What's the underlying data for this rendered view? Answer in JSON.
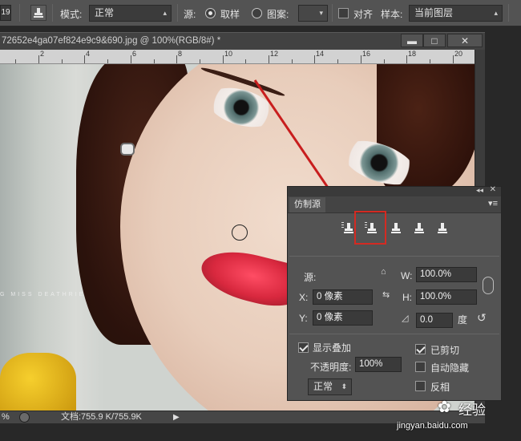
{
  "options_bar": {
    "brush_size": "19",
    "mode_label": "模式:",
    "mode_value": "正常",
    "source_label": "源:",
    "source_sampled": "取样",
    "source_pattern": "图案:",
    "aligned_label": "对齐",
    "sample_label": "样本:",
    "sample_value": "当前图层"
  },
  "document": {
    "title": "72652e4ga07ef824e9c9&690.jpg @ 100%(RGB/8#) *",
    "ruler_numbers": [
      "2",
      "4",
      "6",
      "8",
      "10",
      "12",
      "14",
      "16",
      "18",
      "20"
    ],
    "watermark": "G MISS DEATHRIE",
    "status_zoom": "%",
    "status_doc": "文档:755.9 K/755.9K"
  },
  "panel": {
    "title": "仿制源",
    "source_label": "源:",
    "x_label": "X:",
    "x_value": "0 像素",
    "y_label": "Y:",
    "y_value": "0 像素",
    "w_label": "W:",
    "w_value": "100.0%",
    "h_label": "H:",
    "h_value": "100.0%",
    "angle_value": "0.0",
    "angle_unit": "度",
    "show_overlay": "显示叠加",
    "opacity_label": "不透明度:",
    "opacity_value": "100%",
    "blend_value": "正常",
    "clipped": "已剪切",
    "auto_hide": "自动隐藏",
    "invert": "反相"
  },
  "watermark_site": {
    "brand": "经验",
    "url": "jingyan.baidu.com"
  },
  "colors": {
    "accent_red": "#d42a22"
  }
}
